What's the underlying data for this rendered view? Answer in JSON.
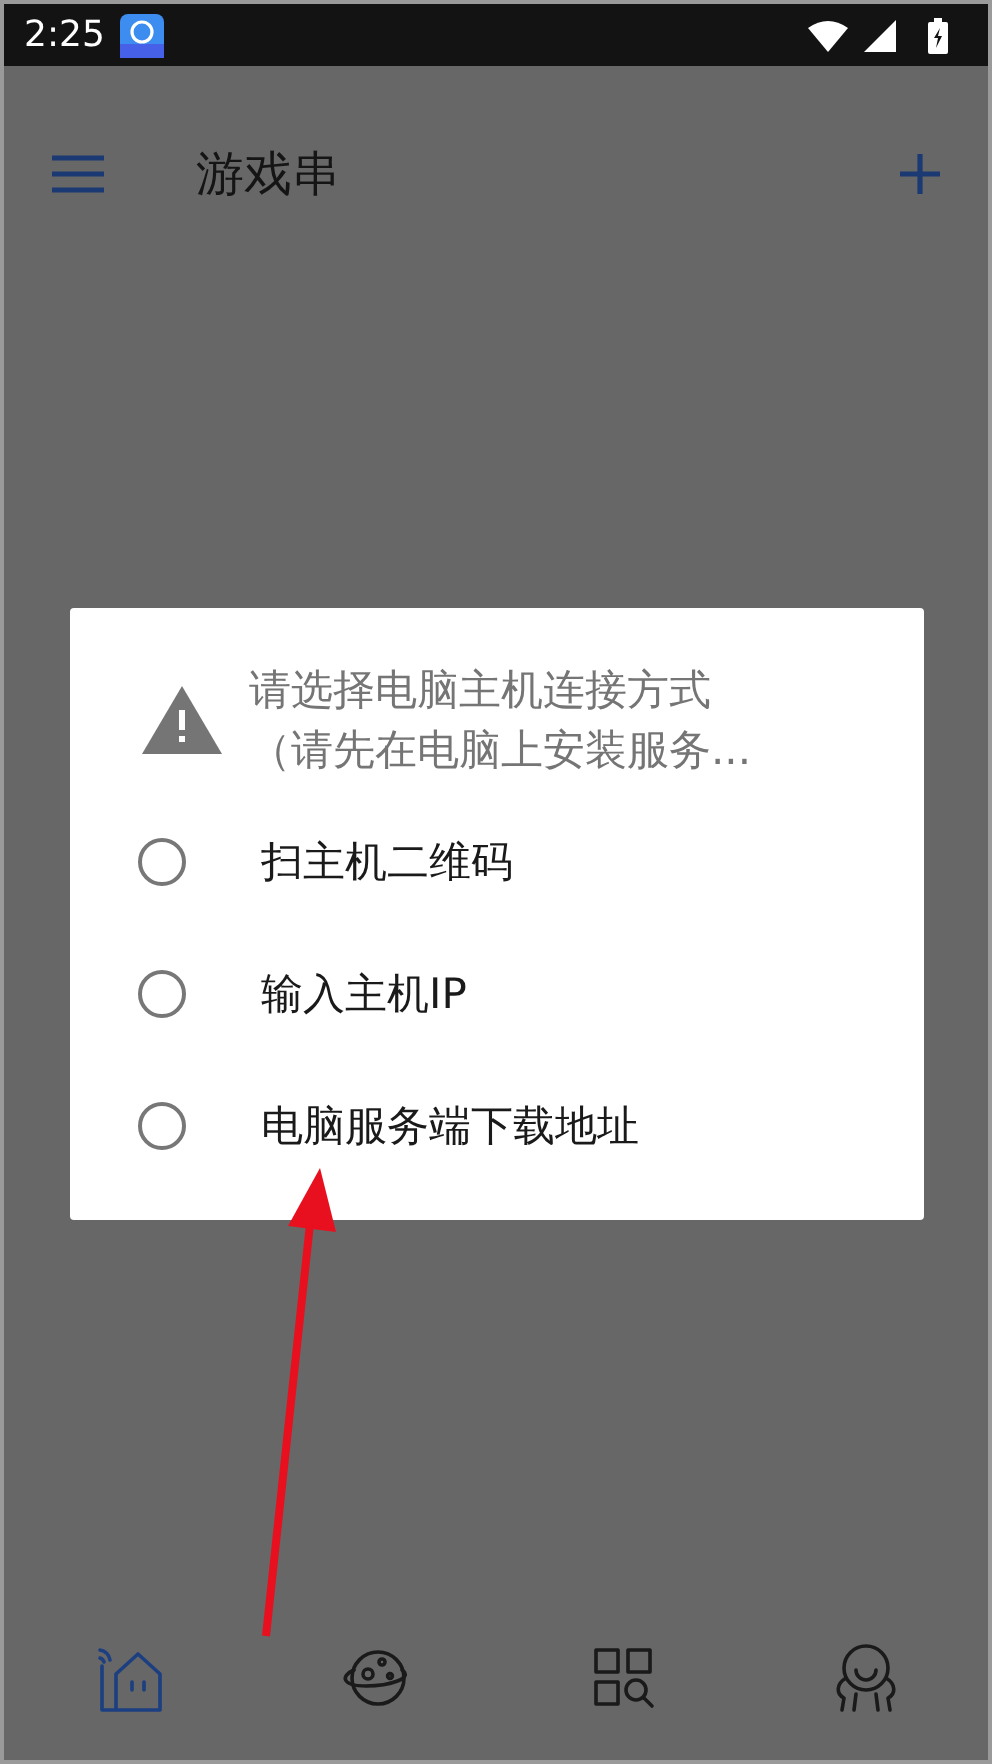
{
  "status_bar": {
    "time": "2:25"
  },
  "app_bar": {
    "title": "游戏串"
  },
  "dialog": {
    "title_lines": [
      "请选择电脑主机连接方式",
      "（请先在电脑上安装服务..."
    ],
    "options": [
      {
        "label": "扫主机二维码",
        "selected": false
      },
      {
        "label": "输入主机IP",
        "selected": false
      },
      {
        "label": "电脑服务端下载地址",
        "selected": false
      }
    ]
  },
  "bottom_nav": [
    {
      "kind": "home",
      "selected": true
    },
    {
      "kind": "planet",
      "selected": false
    },
    {
      "kind": "apps",
      "selected": false
    },
    {
      "kind": "profile",
      "selected": false
    }
  ]
}
